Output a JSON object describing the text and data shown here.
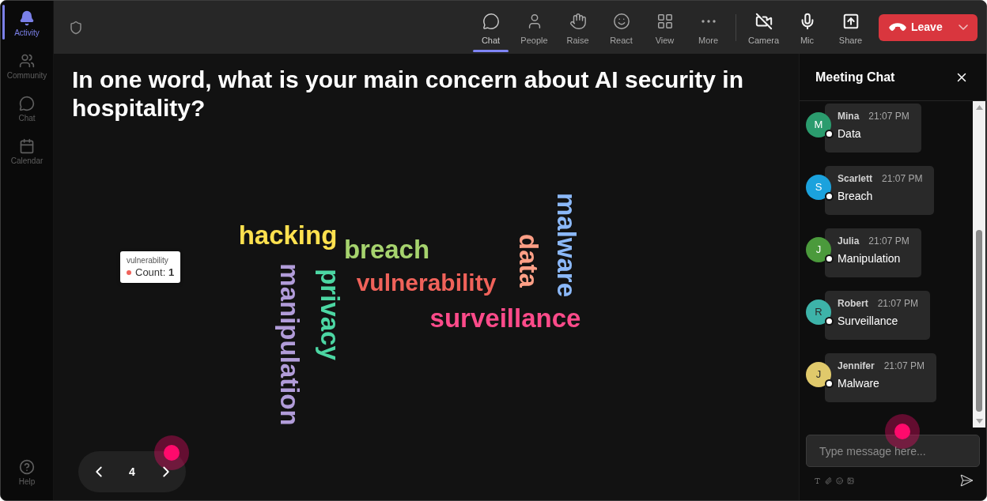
{
  "sidebar": {
    "items": [
      {
        "label": "Activity",
        "selected": true
      },
      {
        "label": "Community",
        "selected": false
      },
      {
        "label": "Chat",
        "selected": false
      },
      {
        "label": "Calendar",
        "selected": false
      }
    ],
    "help": {
      "label": "Help"
    }
  },
  "toolbar": {
    "items": [
      {
        "label": "Chat",
        "selected": true
      },
      {
        "label": "People",
        "selected": false
      },
      {
        "label": "Raise",
        "selected": false
      },
      {
        "label": "React",
        "selected": false
      },
      {
        "label": "View",
        "selected": false
      },
      {
        "label": "More",
        "selected": false
      }
    ],
    "devices": [
      {
        "label": "Camera"
      },
      {
        "label": "Mic"
      },
      {
        "label": "Share"
      }
    ],
    "leave_button": {
      "label": "Leave"
    }
  },
  "question": "In one word, what is your main concern about AI security in hospitality?",
  "word_cloud": {
    "words": [
      {
        "text": "hacking",
        "kind": "horizontal",
        "color": "#ffe14f"
      },
      {
        "text": "breach",
        "kind": "horizontal",
        "color": "#a6d36e"
      },
      {
        "text": "vulnerability",
        "kind": "horizontal",
        "color": "#f0625a"
      },
      {
        "text": "surveillance",
        "kind": "horizontal",
        "color": "#fd4b8a"
      },
      {
        "text": "data",
        "kind": "vertical",
        "color": "#ff9f86"
      },
      {
        "text": "malware",
        "kind": "vertical",
        "color": "#8bb8f8"
      },
      {
        "text": "privacy",
        "kind": "vertical",
        "color": "#4cd6a3"
      },
      {
        "text": "manipulation",
        "kind": "vertical",
        "color": "#b19cd9"
      }
    ],
    "tooltip": {
      "title": "vulnerability",
      "color": "#f0625a",
      "text": "Count: **1**"
    }
  },
  "pager": {
    "page": "4"
  },
  "chat": {
    "title": "Meeting Chat",
    "messages": [
      {
        "author": "Mina",
        "initial": "M",
        "color": "#2b9c6e",
        "time": "21:07 PM",
        "text": "Data"
      },
      {
        "author": "Scarlett",
        "initial": "S",
        "color": "#1ba2dd",
        "time": "21:07 PM",
        "text": "Breach"
      },
      {
        "author": "Julia",
        "initial": "J",
        "color": "#4b9a3c",
        "time": "21:07 PM",
        "text": "Manipulation"
      },
      {
        "author": "Robert",
        "initial": "R",
        "color": "#3db3a9",
        "time": "21:07 PM",
        "text": "Surveillance"
      },
      {
        "author": "Jennifer",
        "initial": "J",
        "color": "#e0c96b",
        "time": "21:07 PM",
        "text": "Malware"
      }
    ],
    "input": {
      "placeholder": "Type message here..."
    }
  }
}
